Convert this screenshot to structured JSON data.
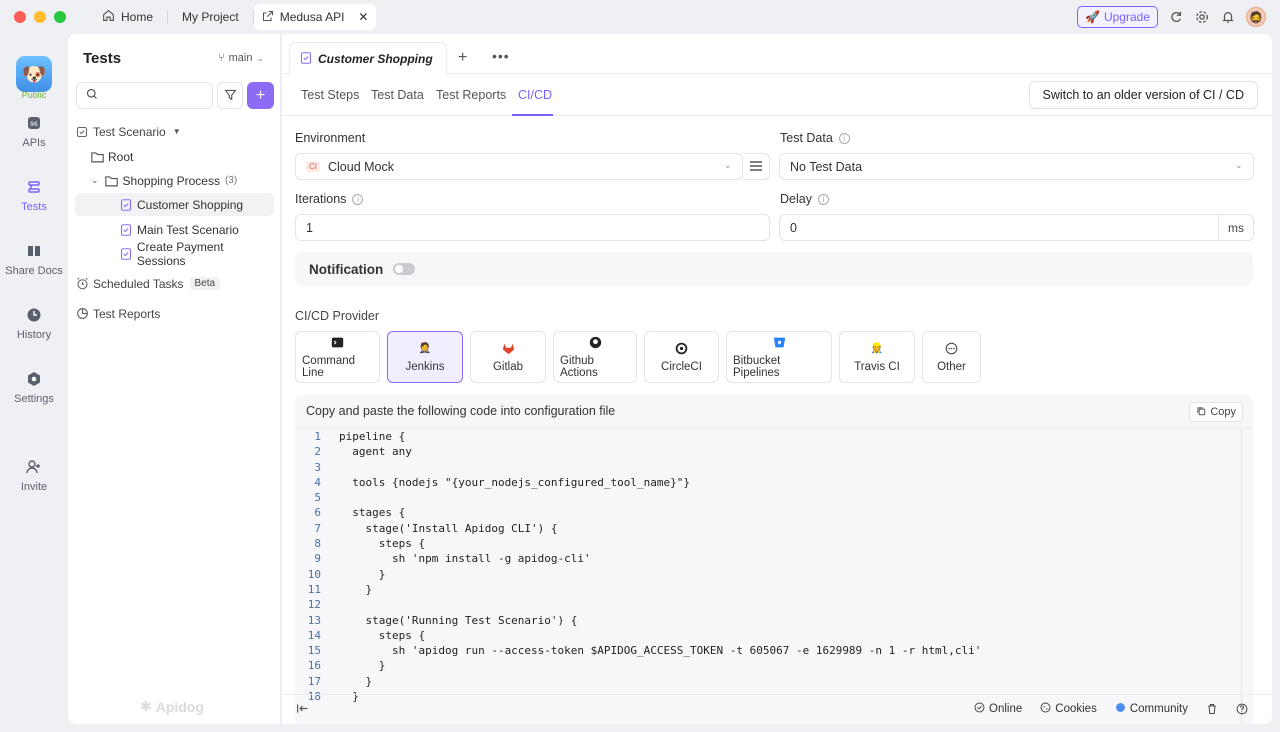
{
  "titlebar": {
    "tabs": [
      {
        "label": "Home"
      },
      {
        "label": "My Project"
      },
      {
        "label": "Medusa API"
      }
    ],
    "upgrade_label": "Upgrade"
  },
  "rail": {
    "public_label": "Public",
    "items": [
      {
        "label": "APIs"
      },
      {
        "label": "Tests"
      },
      {
        "label": "Share Docs"
      },
      {
        "label": "History"
      },
      {
        "label": "Settings"
      },
      {
        "label": "Invite"
      }
    ]
  },
  "sidebar": {
    "title": "Tests",
    "branch": "main",
    "tree": {
      "scenario": "Test Scenario",
      "root": "Root",
      "folder": "Shopping Process",
      "folder_count": "(3)",
      "items": [
        "Customer Shopping",
        "Main Test Scenario",
        "Create Payment Sessions"
      ],
      "scheduled": "Scheduled Tasks",
      "beta": "Beta",
      "reports": "Test Reports"
    },
    "watermark": "Apidog"
  },
  "main": {
    "doc_tab": "Customer Shopping",
    "subtabs": [
      "Test Steps",
      "Test Data",
      "Test Reports",
      "CI/CD"
    ],
    "switch_button": "Switch to an older version of CI / CD",
    "environment_label": "Environment",
    "environment_badge": "CI",
    "environment_value": "Cloud Mock",
    "test_data_label": "Test Data",
    "test_data_value": "No Test Data",
    "iterations_label": "Iterations",
    "iterations_value": "1",
    "delay_label": "Delay",
    "delay_value": "0",
    "delay_unit": "ms",
    "notification_label": "Notification",
    "provider_label": "CI/CD Provider",
    "providers": [
      "Command Line",
      "Jenkins",
      "Gitlab",
      "Github Actions",
      "CircleCI",
      "Bitbucket Pipelines",
      "Travis CI",
      "Other"
    ],
    "code_hint": "Copy and paste the following code into configuration file",
    "copy_label": "Copy",
    "code_lines": [
      "pipeline {",
      "  agent any",
      "",
      "  tools {nodejs \"{your_nodejs_configured_tool_name}\"}",
      "",
      "  stages {",
      "    stage('Install Apidog CLI') {",
      "      steps {",
      "        sh 'npm install -g apidog-cli'",
      "      }",
      "    }",
      "",
      "    stage('Running Test Scenario') {",
      "      steps {",
      "        sh 'apidog run --access-token $APIDOG_ACCESS_TOKEN -t 605067 -e 1629989 -n 1 -r html,cli'",
      "      }",
      "    }",
      "  }"
    ]
  },
  "footer": {
    "online": "Online",
    "cookies": "Cookies",
    "community": "Community"
  }
}
